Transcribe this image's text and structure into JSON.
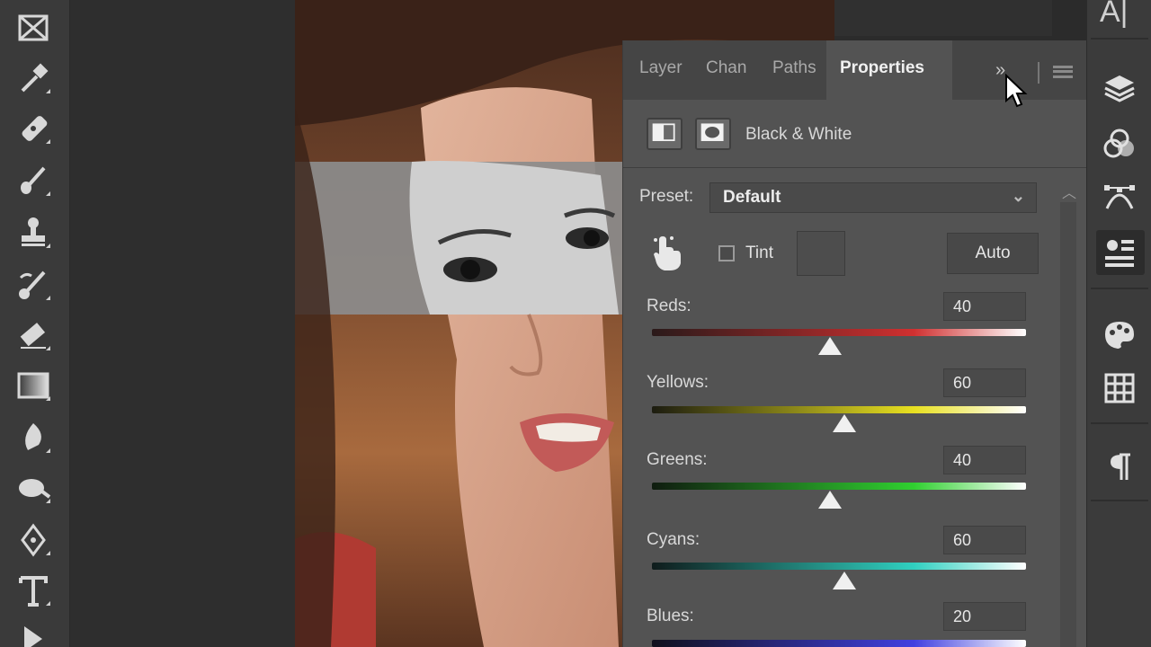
{
  "panel": {
    "tabs": [
      {
        "label": "Layer"
      },
      {
        "label": "Chan"
      },
      {
        "label": "Paths"
      },
      {
        "label": "Properties"
      }
    ],
    "collapse_icon": "»",
    "adjustment_title": "Black & White",
    "preset_label": "Preset:",
    "preset_value": "Default",
    "tint_label": "Tint",
    "tint_checked": false,
    "auto_label": "Auto",
    "sliders": [
      {
        "label": "Reds:",
        "value": "40",
        "fraction": 0.48
      },
      {
        "label": "Yellows:",
        "value": "60",
        "fraction": 0.51
      },
      {
        "label": "Greens:",
        "value": "40",
        "fraction": 0.48
      },
      {
        "label": "Cyans:",
        "value": "60",
        "fraction": 0.51
      },
      {
        "label": "Blues:",
        "value": "20"
      }
    ]
  },
  "dock": {
    "top_label": "A|"
  },
  "colors": {
    "panel_bg": "#535353",
    "toolbar_bg": "#3a3a3a",
    "reds_gradient": [
      "#2a1a1a",
      "#d03030",
      "#ffffff"
    ],
    "yellows_gradient": [
      "#1c1c10",
      "#e8e020",
      "#ffffff"
    ],
    "greens_gradient": [
      "#0f1c0f",
      "#30d030",
      "#ffffff"
    ],
    "cyans_gradient": [
      "#0f1c1c",
      "#30d0c0",
      "#ffffff"
    ],
    "blues_gradient": [
      "#10101c",
      "#4040e0",
      "#ffffff"
    ]
  }
}
